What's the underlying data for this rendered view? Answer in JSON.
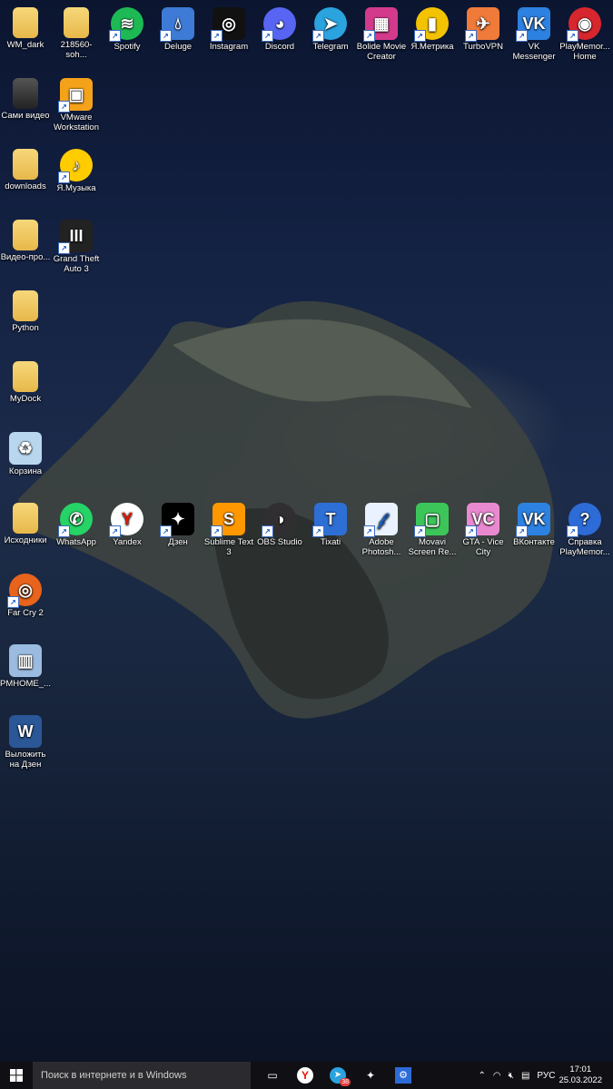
{
  "desktop": {
    "icons": [
      {
        "label": "WM_dark",
        "icon": "folder-icon",
        "color": "#e9bd52",
        "col": 0,
        "row": 0,
        "shortcut": false
      },
      {
        "label": "218560-soh...",
        "icon": "folder-icon",
        "color": "#e9bd52",
        "col": 1,
        "row": 0,
        "shortcut": false
      },
      {
        "label": "Spotify",
        "icon": "spotify-icon",
        "color": "#1db954",
        "col": 2,
        "row": 0,
        "shortcut": true
      },
      {
        "label": "Deluge",
        "icon": "deluge-icon",
        "color": "#3d7bd6",
        "col": 3,
        "row": 0,
        "shortcut": true
      },
      {
        "label": "Instagram",
        "icon": "instagram-icon",
        "color": "#111111",
        "col": 4,
        "row": 0,
        "shortcut": true
      },
      {
        "label": "Discord",
        "icon": "discord-icon",
        "color": "#5865f2",
        "col": 5,
        "row": 0,
        "shortcut": true
      },
      {
        "label": "Telegram",
        "icon": "telegram-icon",
        "color": "#2aa3df",
        "col": 6,
        "row": 0,
        "shortcut": true
      },
      {
        "label": "Bolide Movie Creator",
        "icon": "bolide-icon",
        "color": "#d43a8c",
        "col": 7,
        "row": 0,
        "shortcut": true
      },
      {
        "label": "Я.Метрика",
        "icon": "metrika-icon",
        "color": "#f4c300",
        "col": 8,
        "row": 0,
        "shortcut": true
      },
      {
        "label": "TurboVPN",
        "icon": "turbovpn-icon",
        "color": "#f07a3a",
        "col": 9,
        "row": 0,
        "shortcut": true
      },
      {
        "label": "VK Messenger",
        "icon": "vk-messenger-icon",
        "color": "#2d81e0",
        "col": 10,
        "row": 0,
        "shortcut": true
      },
      {
        "label": "PlayMemor... Home",
        "icon": "playmemories-icon",
        "color": "#d8262e",
        "col": 11,
        "row": 0,
        "shortcut": true
      },
      {
        "label": "Сами видео",
        "icon": "folder-icon",
        "color": "#3a3a3a",
        "col": 0,
        "row": 1,
        "shortcut": false
      },
      {
        "label": "VMware Workstation",
        "icon": "vmware-icon",
        "color": "#f5a21b",
        "col": 1,
        "row": 1,
        "shortcut": true
      },
      {
        "label": "downloads",
        "icon": "folder-icon",
        "color": "#e9bd52",
        "col": 0,
        "row": 2,
        "shortcut": false
      },
      {
        "label": "Я.Музыка",
        "icon": "ya-music-icon",
        "color": "#ffcc00",
        "col": 1,
        "row": 2,
        "shortcut": true
      },
      {
        "label": "Видео-про...",
        "icon": "folder-icon",
        "color": "#e9bd52",
        "col": 0,
        "row": 3,
        "shortcut": false
      },
      {
        "label": "Grand Theft Auto 3",
        "icon": "gta3-icon",
        "color": "#222222",
        "col": 1,
        "row": 3,
        "shortcut": true
      },
      {
        "label": "Python",
        "icon": "folder-icon",
        "color": "#e9bd52",
        "col": 0,
        "row": 4,
        "shortcut": false
      },
      {
        "label": "MyDock",
        "icon": "folder-icon",
        "color": "#e9bd52",
        "col": 0,
        "row": 5,
        "shortcut": false
      },
      {
        "label": "Корзина",
        "icon": "recycle-bin-icon",
        "color": "#b8d6ee",
        "col": 0,
        "row": 6,
        "shortcut": false
      },
      {
        "label": "Исходники",
        "icon": "folder-icon",
        "color": "#e9bd52",
        "col": 0,
        "row": 7,
        "shortcut": false
      },
      {
        "label": "WhatsApp",
        "icon": "whatsapp-icon",
        "color": "#25d366",
        "col": 1,
        "row": 7,
        "shortcut": true
      },
      {
        "label": "Yandex",
        "icon": "yandex-icon",
        "color": "#ffffff",
        "col": 2,
        "row": 7,
        "shortcut": true
      },
      {
        "label": "Дзен",
        "icon": "dzen-icon",
        "color": "#000000",
        "col": 3,
        "row": 7,
        "shortcut": true
      },
      {
        "label": "Sublime Text 3",
        "icon": "sublime-icon",
        "color": "#ff9800",
        "col": 4,
        "row": 7,
        "shortcut": true
      },
      {
        "label": "OBS Studio",
        "icon": "obs-icon",
        "color": "#302e31",
        "col": 5,
        "row": 7,
        "shortcut": true
      },
      {
        "label": "Tixati",
        "icon": "tixati-icon",
        "color": "#2e6fd6",
        "col": 6,
        "row": 7,
        "shortcut": true
      },
      {
        "label": "Adobe Photosh...",
        "icon": "photoshop-icon",
        "color": "#eaf2ff",
        "col": 7,
        "row": 7,
        "shortcut": true
      },
      {
        "label": "Movavi Screen Re...",
        "icon": "movavi-icon",
        "color": "#3cc65a",
        "col": 8,
        "row": 7,
        "shortcut": true
      },
      {
        "label": "GTA - Vice City",
        "icon": "gta-vc-icon",
        "color": "#e98ad0",
        "col": 9,
        "row": 7,
        "shortcut": true
      },
      {
        "label": "ВКонтакте",
        "icon": "vk-icon",
        "color": "#2d81e0",
        "col": 10,
        "row": 7,
        "shortcut": true
      },
      {
        "label": "Справка PlayMemor...",
        "icon": "help-icon",
        "color": "#2d6bd6",
        "col": 11,
        "row": 7,
        "shortcut": true
      },
      {
        "label": "Far Cry 2",
        "icon": "farcry2-icon",
        "color": "#e8631b",
        "col": 0,
        "row": 8,
        "shortcut": true
      },
      {
        "label": "PMHOME_...",
        "icon": "installer-icon",
        "color": "#9bbbe0",
        "col": 0,
        "row": 9,
        "shortcut": false
      },
      {
        "label": "Выложить на Дзен",
        "icon": "word-doc-icon",
        "color": "#2b5797",
        "col": 0,
        "row": 10,
        "shortcut": false
      }
    ]
  },
  "taskbar": {
    "search_placeholder": "Поиск в интернете и в Windows",
    "apps": [
      {
        "name": "task-view-icon",
        "glyph": "▭"
      },
      {
        "name": "yandex-browser-icon",
        "glyph": "Y"
      },
      {
        "name": "telegram-taskbar-icon",
        "glyph": "➤",
        "badge": "38"
      },
      {
        "name": "dzen-taskbar-icon",
        "glyph": "✦"
      },
      {
        "name": "settings-taskbar-icon",
        "glyph": "⚙"
      }
    ],
    "tray": {
      "language": "РУС",
      "time": "17:01",
      "date": "25.03.2022"
    }
  }
}
